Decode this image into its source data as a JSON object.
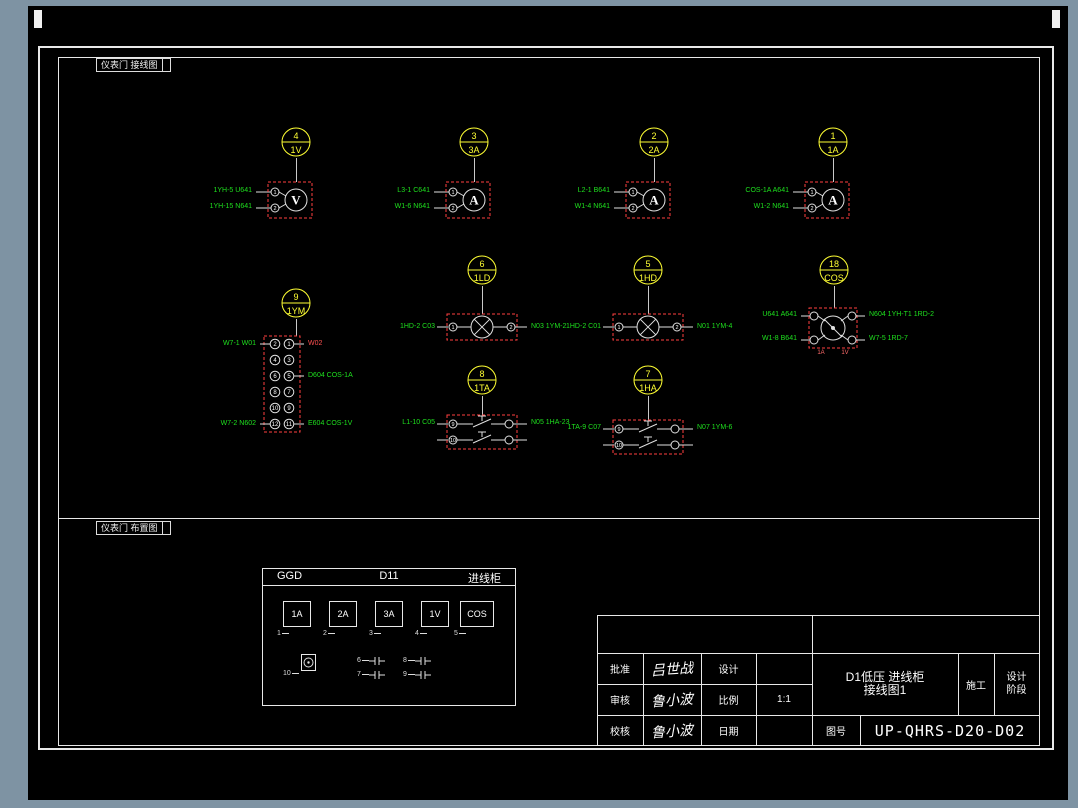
{
  "sections": {
    "wiring_label": "仪表门 接线图",
    "layout_label": "仪表门 布置图"
  },
  "tags": [
    {
      "num": "4",
      "label": "1V"
    },
    {
      "num": "3",
      "label": "3A"
    },
    {
      "num": "2",
      "label": "2A"
    },
    {
      "num": "1",
      "label": "1A"
    },
    {
      "num": "6",
      "label": "1LD"
    },
    {
      "num": "5",
      "label": "1HD"
    },
    {
      "num": "18",
      "label": "COS"
    },
    {
      "num": "9",
      "label": "1YM"
    },
    {
      "num": "8",
      "label": "1TA"
    },
    {
      "num": "7",
      "label": "1HA"
    }
  ],
  "meters": [
    {
      "letter": "V",
      "t1": "1",
      "t2": "2",
      "lt": "1YH-5 U641",
      "lb": "1YH-15 N641"
    },
    {
      "letter": "A",
      "t1": "1",
      "t2": "2",
      "lt": "L3-1 C641",
      "lb": "W1-6 N641"
    },
    {
      "letter": "A",
      "t1": "1",
      "t2": "2",
      "lt": "L2-1 B641",
      "lb": "W1-4 N641"
    },
    {
      "letter": "A",
      "t1": "1",
      "t2": "2",
      "lt": "COS-1A A641",
      "lb": "W1-2 N641"
    }
  ],
  "lamps": [
    {
      "t1": "1",
      "t2": "2",
      "ll": "1HD-2 C03",
      "lr": "N03 1YM-2"
    },
    {
      "t1": "1",
      "t2": "2",
      "ll": "1HD-2 C01",
      "lr": "N01 1YM-4"
    }
  ],
  "buttons": [
    {
      "t1": "9",
      "t2": "10",
      "ll": "L1-10 C05",
      "lr": "N05 1HA-23"
    },
    {
      "t1": "9",
      "t2": "10",
      "ll": "1TA-9 C07",
      "lr": "N07 1YM-6"
    }
  ],
  "cos": {
    "lt": "U641 A641",
    "lb": "W1-8 B641",
    "rt": "N604 1YH-T1 1RD-2",
    "rb": "W7-5 1RD-7",
    "b1": "1A",
    "b2": "1V"
  },
  "strip": {
    "left": [
      "2",
      "4",
      "6",
      "8",
      "10",
      "12"
    ],
    "right": [
      "1",
      "3",
      "5",
      "7",
      "9",
      "11"
    ],
    "lt": "W7-1 W01",
    "lb": "W7-2 N602",
    "rt": "W02",
    "rm": "D604 COS-1A",
    "rb": "E604 COS-1V"
  },
  "layout": {
    "header": {
      "left": "GGD",
      "mid": "D11",
      "right": "进线柜"
    },
    "boxes": [
      {
        "label": "1A",
        "idx": "1"
      },
      {
        "label": "2A",
        "idx": "2"
      },
      {
        "label": "3A",
        "idx": "3"
      },
      {
        "label": "1V",
        "idx": "4"
      },
      {
        "label": "COS",
        "idx": "5"
      }
    ],
    "lamp_idx": "10",
    "btn_idx": [
      "6",
      "7",
      "8",
      "9"
    ]
  },
  "titleblock": {
    "rows": [
      {
        "label": "批准",
        "sig": "吕世战",
        "label2": "设计",
        "value": ""
      },
      {
        "label": "审核",
        "sig": "鲁小波",
        "label2": "比例",
        "value": "1:1"
      },
      {
        "label": "校核",
        "sig": "鲁小波",
        "label2": "日期",
        "value": ""
      }
    ],
    "title_line1": "D1低压 进线柜",
    "title_line2": "接线图1",
    "col_construction": "施工",
    "col_stage1": "设计",
    "col_stage2": "阶段",
    "drawing_no_label": "图号",
    "drawing_no": "UP-QHRS-D20-D02"
  }
}
